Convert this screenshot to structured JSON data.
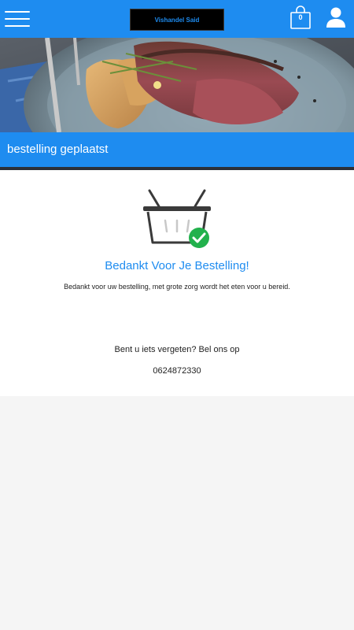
{
  "header": {
    "menu_icon": "hamburger-menu-icon",
    "logo_text": "Vishandel Said",
    "cart_icon": "shopping-bag-icon",
    "cart_count": "0",
    "user_icon": "user-icon"
  },
  "hero": {
    "image": "grilled-steak-photo"
  },
  "page": {
    "title": "bestelling geplaatst"
  },
  "confirmation": {
    "icon": "basket-check-icon",
    "heading": "Bedankt Voor Je Bestelling!",
    "message": "Bedankt voor uw bestelling, met grote zorg wordt het eten voor u bereid.",
    "forgot_text": "Bent u iets vergeten? Bel ons op",
    "phone": "0624872330"
  },
  "colors": {
    "accent": "#1e8cf0",
    "success": "#22b14c",
    "dark_bar": "#2c3038"
  }
}
